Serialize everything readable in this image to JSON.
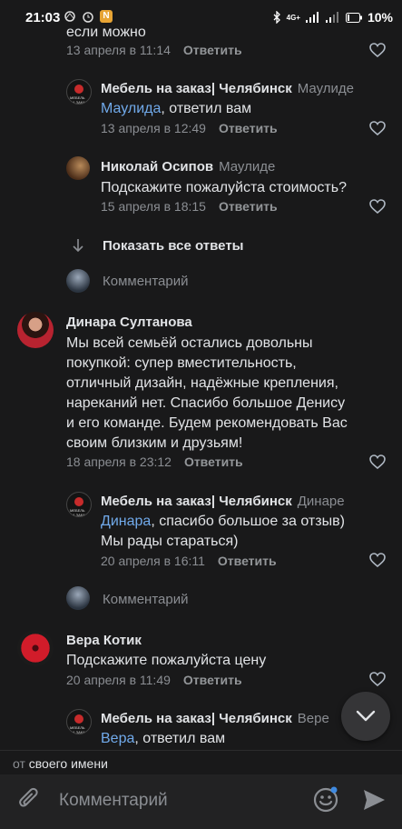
{
  "status_bar": {
    "time": "21:03",
    "net_label": "4G+",
    "battery": "10%",
    "notification_badge": "N"
  },
  "thread": {
    "cut_text": "если можно",
    "cut_meta": {
      "date": "13 апреля в 11:14",
      "reply_label": "Ответить"
    },
    "replies_1": [
      {
        "author": "Мебель на заказ| Челябинск",
        "reply_to": "Маулиде",
        "mention": "Маулида",
        "text": ", ответил вам",
        "date": "13 апреля в 12:49",
        "reply_label": "Ответить"
      },
      {
        "author": "Николай Осипов",
        "reply_to": "Маулиде",
        "text": "Подскажите пожалуйста стоимость?",
        "date": "15 апреля в 18:15",
        "reply_label": "Ответить"
      }
    ],
    "show_all_replies": "Показать все ответы",
    "comment_placeholder": "Комментарий"
  },
  "comments": [
    {
      "author": "Динара Султанова",
      "text_lines": [
        "Мы всей семьёй остались довольны",
        "покупкой: супер вместительность,",
        "отличный дизайн, надёжные крепления,",
        "нареканий нет. Спасибо большое Денису",
        "и его команде. Будем рекомендовать Вас",
        "своим близким и друзьям!"
      ],
      "date": "18 апреля в 23:12",
      "reply_label": "Ответить",
      "reply": {
        "author": "Мебель на заказ| Челябинск",
        "reply_to": "Динаре",
        "mention": "Динара",
        "text_line1": ", спасибо большое за отзыв)",
        "text_line2": "Мы рады стараться)",
        "date": "20 апреля в 16:11",
        "reply_label": "Ответить"
      },
      "comment_placeholder": "Комментарий"
    },
    {
      "author": "Вера Котик",
      "text": "Подскажите пожалуйста цену",
      "date": "20 апреля в 11:49",
      "reply_label": "Ответить",
      "reply": {
        "author": "Мебель на заказ| Челябинск",
        "reply_to": "Вере",
        "mention": "Вера",
        "text": ", ответил вам"
      }
    }
  ],
  "composer": {
    "from_prefix": "от",
    "from_value": "своего имени",
    "placeholder": "Комментарий"
  },
  "colors": {
    "background": "#19191a",
    "link": "#71aaeb",
    "muted": "#8b8e93"
  }
}
